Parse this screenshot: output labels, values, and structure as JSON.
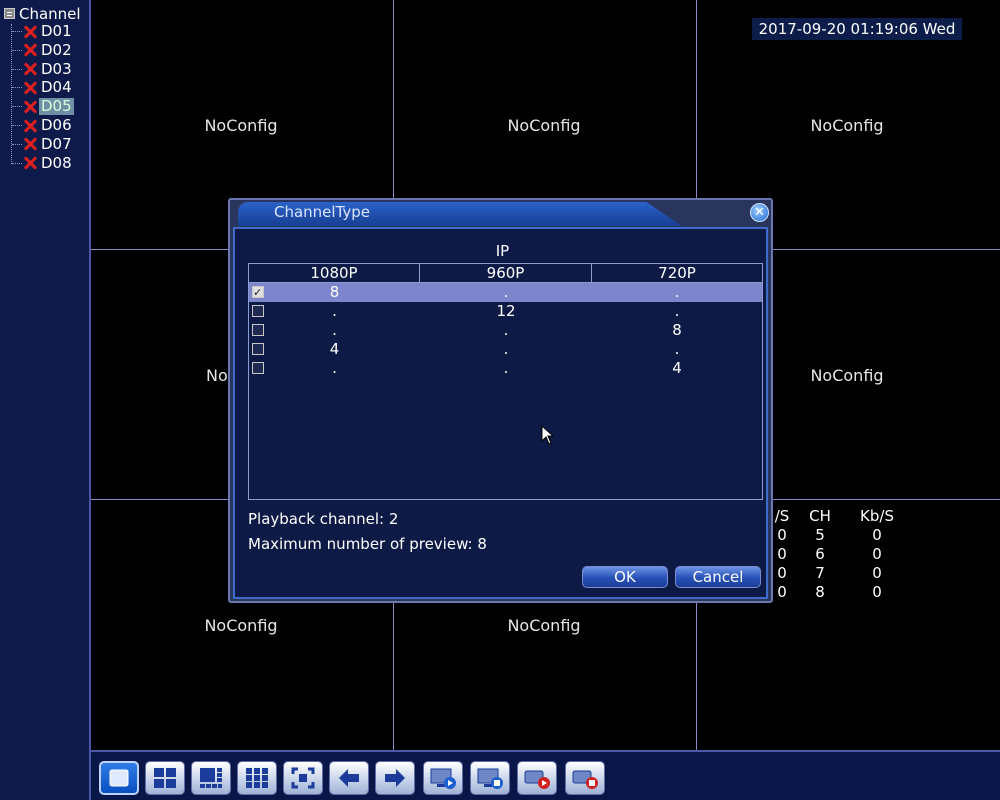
{
  "sidebar": {
    "root_label": "Channel",
    "channels": [
      "D01",
      "D02",
      "D03",
      "D04",
      "D05",
      "D06",
      "D07",
      "D08"
    ],
    "selected": "D05",
    "status_icon": "x-icon"
  },
  "grid": {
    "cell_label": "NoConfig",
    "datetime": "2017-09-20 01:19:06 Wed",
    "partial_label": "No",
    "stats": {
      "headers": [
        "/S",
        "CH",
        "Kb/S"
      ],
      "rows": [
        [
          "0",
          "5",
          "0"
        ],
        [
          "0",
          "6",
          "0"
        ],
        [
          "0",
          "7",
          "0"
        ],
        [
          "0",
          "8",
          "0"
        ]
      ]
    }
  },
  "dialog": {
    "title": "ChannelType",
    "close_glyph": "✕",
    "group_label": "IP",
    "columns": [
      "1080P",
      "960P",
      "720P"
    ],
    "rows": [
      {
        "checked": true,
        "values": [
          "8",
          ".",
          "."
        ]
      },
      {
        "checked": false,
        "values": [
          ".",
          "12",
          "."
        ]
      },
      {
        "checked": false,
        "values": [
          ".",
          ".",
          "8"
        ]
      },
      {
        "checked": false,
        "values": [
          "4",
          ".",
          "."
        ]
      },
      {
        "checked": false,
        "values": [
          ".",
          ".",
          "4"
        ]
      }
    ],
    "playback_channel": "Playback channel: 2",
    "max_preview": "Maximum number of preview: 8",
    "ok_label": "OK",
    "cancel_label": "Cancel"
  },
  "toolbar": {
    "buttons": [
      "single-view-icon",
      "quad-view-icon",
      "multi-view-icon",
      "nine-view-icon",
      "fullscreen-icon",
      "previous-icon",
      "next-icon",
      "playback-icon",
      "record-icon",
      "record-start-icon",
      "record-stop-icon"
    ]
  }
}
